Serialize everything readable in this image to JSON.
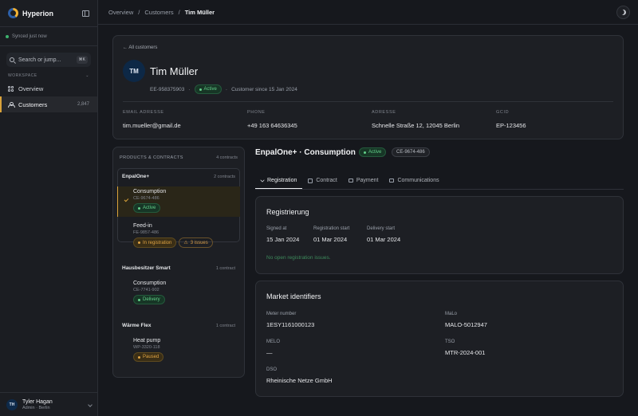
{
  "app": {
    "name": "Hyperion",
    "sync_status": "Synced just now"
  },
  "search": {
    "placeholder": "Search or jump...",
    "shortcut": "⌘K"
  },
  "sidebar": {
    "section_label": "WORKSPACE",
    "items": [
      {
        "label": "Overview",
        "icon": "grid-icon",
        "count": ""
      },
      {
        "label": "Customers",
        "icon": "user-icon",
        "count": "2,847"
      }
    ]
  },
  "user": {
    "initials": "TH",
    "name": "Tyler Hagan",
    "role": "Admin · Berlin"
  },
  "breadcrumb": {
    "items": [
      "Overview",
      "Customers"
    ],
    "current": "Tim Müller",
    "separator": "/"
  },
  "customer": {
    "back_label": "All customers",
    "initials": "TM",
    "name": "Tim Müller",
    "id": "EE-958375903",
    "status": "Active",
    "since": "Customer since 15 Jan 2024",
    "fields": [
      {
        "label": "EMAIL ADRESSE",
        "value": "tim.mueller@gmail.de"
      },
      {
        "label": "PHONE",
        "value": "+49 163 64636345"
      },
      {
        "label": "ADRESSE",
        "value": "Schnelle Straße 12, 12045 Berlin"
      },
      {
        "label": "GCID",
        "value": "EP-123456"
      }
    ]
  },
  "products": {
    "title": "PRODUCTS & CONTRACTS",
    "count": "4 contracts",
    "groups": [
      {
        "name": "EnpalOne+",
        "count": "2 contracts",
        "items": [
          {
            "name": "Consumption",
            "id": "CE-9674-486",
            "badges": [
              "Active"
            ]
          },
          {
            "name": "Feed-in",
            "id": "FE-9857-486",
            "badges": [
              "In registration",
              "3 issues"
            ]
          }
        ]
      },
      {
        "name": "Hausbesitzer Smart",
        "count": "1 contract",
        "items": [
          {
            "name": "Consumption",
            "id": "CE-7741-902",
            "badges": [
              "Delivery"
            ]
          }
        ]
      },
      {
        "name": "Wärme Flex",
        "count": "1 contract",
        "items": [
          {
            "name": "Heat pump",
            "id": "WP-3320-118",
            "badges": [
              "Paused"
            ]
          }
        ]
      }
    ]
  },
  "contract": {
    "title": "EnpalOne+ · Consumption",
    "status": "Active",
    "id": "CE-9674-486",
    "tabs": [
      "Registration",
      "Contract",
      "Payment",
      "Communications"
    ],
    "active_tab": "Registration"
  },
  "registration": {
    "title": "Registrierung",
    "fields": [
      {
        "label": "Signed at",
        "value": "15 Jan 2024"
      },
      {
        "label": "Registration start",
        "value": "01 Mar 2024"
      },
      {
        "label": "Delivery start",
        "value": "01 Mar 2024"
      }
    ],
    "issues_text": "No open registration issues."
  },
  "market": {
    "title": "Market identifiers",
    "fields": [
      {
        "label": "Meter number",
        "value": "1ESY1161000123"
      },
      {
        "label": "MaLo",
        "value": "MALO-5012947"
      },
      {
        "label": "MELO",
        "value": "—"
      },
      {
        "label": "TSO",
        "value": "MTR-2024-001"
      },
      {
        "label": "DSO",
        "value": "Rheinische Netze GmbH"
      }
    ]
  },
  "colors": {
    "accent": "#d9a23a",
    "success": "#63d08a",
    "warning": "#e0a443",
    "background": "#16181d"
  }
}
